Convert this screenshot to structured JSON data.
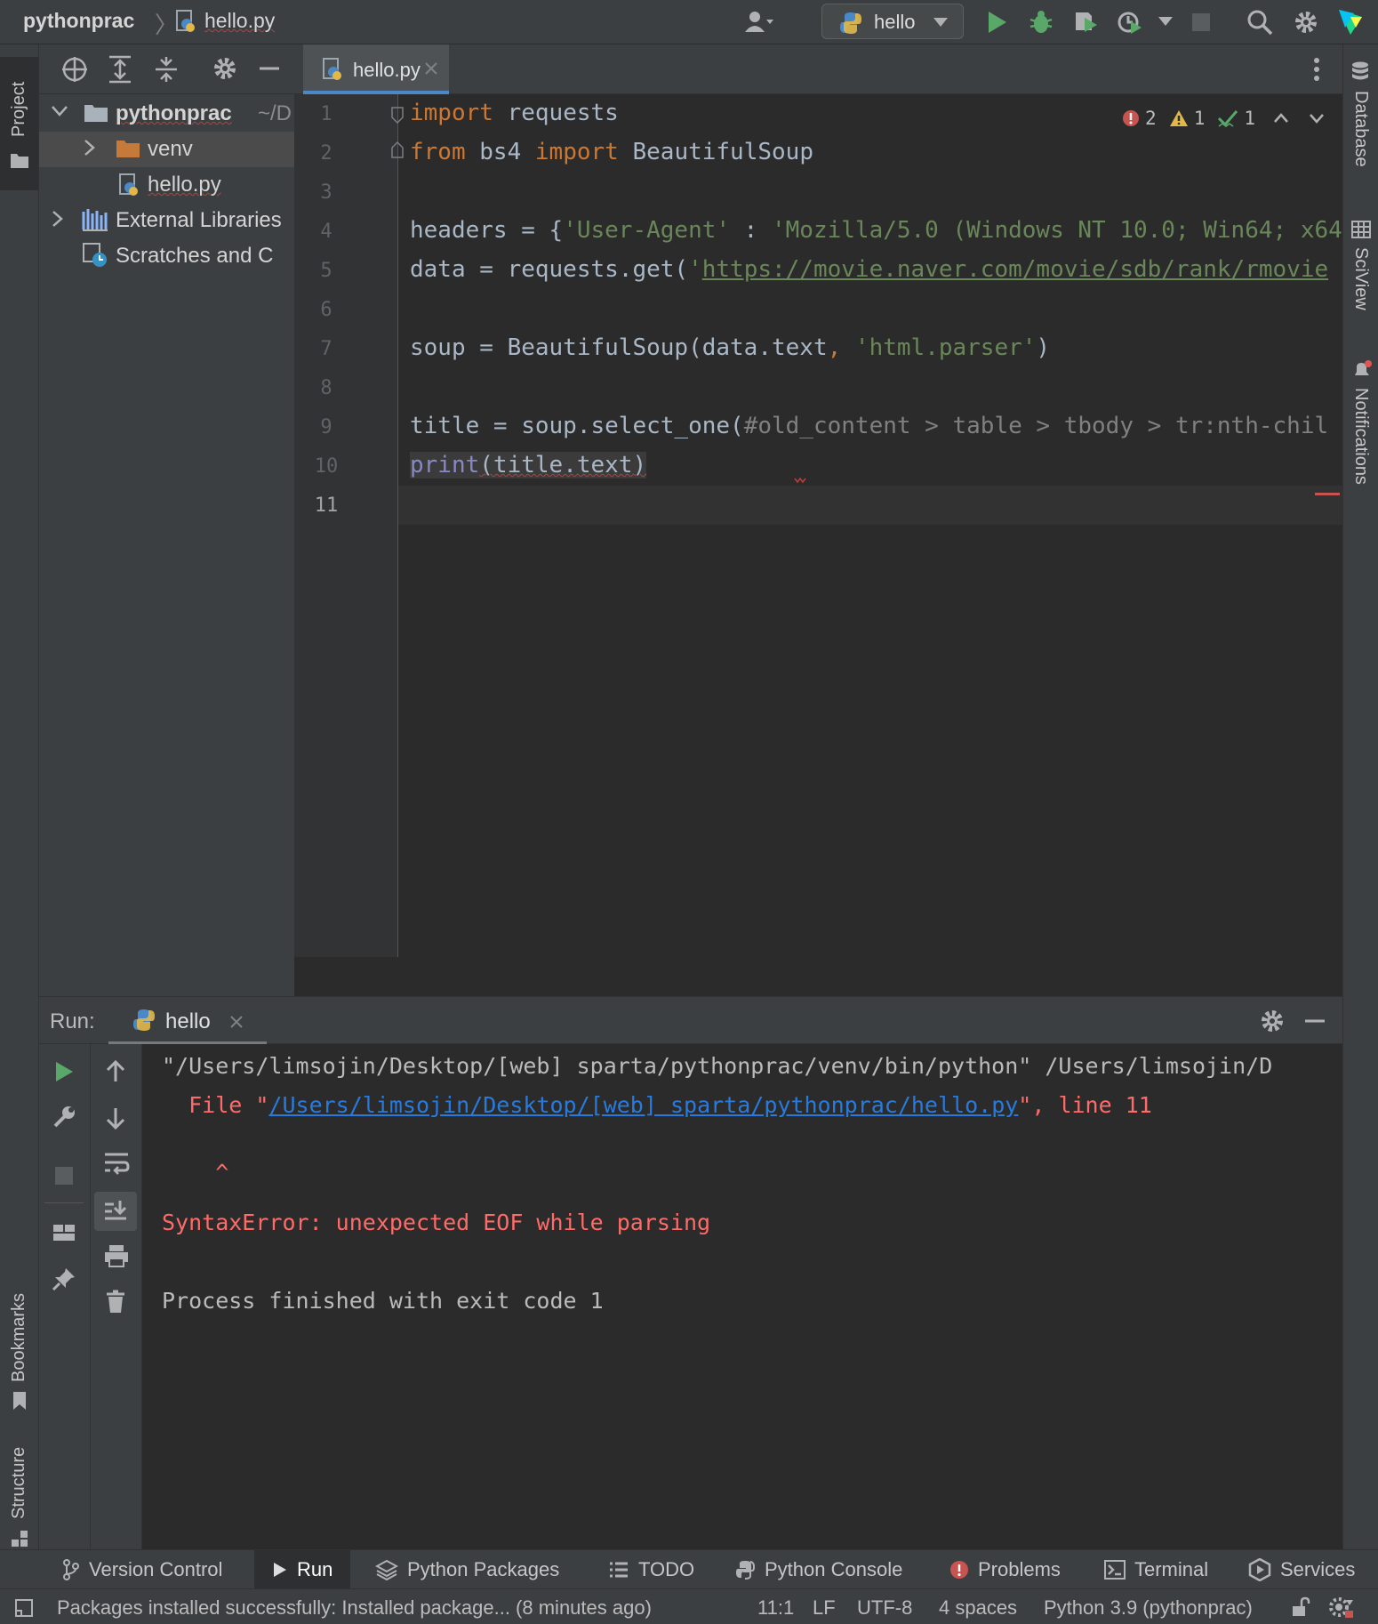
{
  "navbar": {
    "project": "pythonprac",
    "file": "hello.py",
    "run_config": "hello"
  },
  "left_stripe": {
    "project_tab": "Project",
    "bookmarks_tab": "Bookmarks",
    "structure_tab": "Structure"
  },
  "right_stripe": {
    "database_tab": "Database",
    "sciview_tab": "SciView",
    "notifications_tab": "Notifications"
  },
  "project_tree": {
    "root_name": "pythonprac",
    "root_path": "~/D",
    "items": [
      {
        "label": "venv"
      },
      {
        "label": "hello.py"
      },
      {
        "label": "External Libraries"
      },
      {
        "label": "Scratches and C"
      }
    ]
  },
  "editor": {
    "tab_label": "hello.py",
    "inspections": {
      "errors": "2",
      "warnings": "1",
      "ok": "1"
    },
    "line_numbers": [
      "1",
      "2",
      "3",
      "4",
      "5",
      "6",
      "7",
      "8",
      "9",
      "10",
      "11"
    ],
    "lines": {
      "l1_kw": "import",
      "l1_rest": " requests",
      "l2_kw1": "from",
      "l2_mid": " bs4 ",
      "l2_kw2": "import",
      "l2_rest": " BeautifulSoup",
      "l4_a": "headers = {",
      "l4_s1": "'User-Agent'",
      "l4_b": " : ",
      "l4_s2": "'Mozilla/5.0 (Windows NT 10.0; Win64; x64",
      "l5_a": "data = requests.get(",
      "l5_q": "'",
      "l5_url": "https://movie.naver.com/movie/sdb/rank/rmovie",
      "l7_a": "soup = BeautifulSoup(data.text",
      "l7_comma": ", ",
      "l7_s": "'html.parser'",
      "l7_b": ")",
      "l9_a": "title = soup.select_one(",
      "l9_c": "#old_content > table > tbody > tr:nth-chil",
      "l10_fn": "print",
      "l10_rest": "(title.text)"
    }
  },
  "run_panel": {
    "label": "Run:",
    "tab": "hello",
    "console": {
      "line1": "\"/Users/limsojin/Desktop/[web] sparta/pythonprac/venv/bin/python\" /Users/limsojin/D",
      "line2_a": "  File \"",
      "line2_link": "/Users/limsojin/Desktop/[web] sparta/pythonprac/hello.py",
      "line2_b": "\", line 11",
      "line3": "    ^",
      "line4": "SyntaxError: unexpected EOF while parsing",
      "line5": "Process finished with exit code 1"
    }
  },
  "tool_bar": {
    "version_control": "Version Control",
    "run": "Run",
    "python_packages": "Python Packages",
    "todo": "TODO",
    "python_console": "Python Console",
    "problems": "Problems",
    "terminal": "Terminal",
    "services": "Services"
  },
  "status_bar": {
    "message": "Packages installed successfully: Installed package... (8 minutes ago)",
    "position": "11:1",
    "line_sep": "LF",
    "encoding": "UTF-8",
    "indent": "4 spaces",
    "interpreter": "Python 3.9 (pythonprac)"
  },
  "colors": {
    "accent": "#4a88c7",
    "run_green": "#59a869",
    "error_red": "#ff6b68",
    "warning_yellow": "#e2b84a"
  }
}
